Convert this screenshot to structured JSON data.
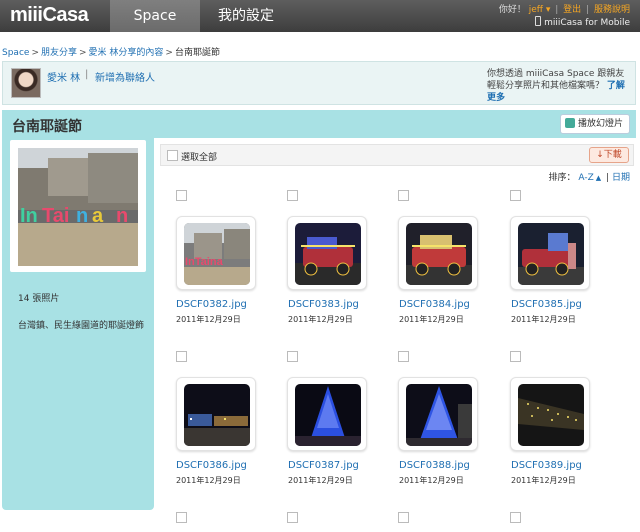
{
  "header": {
    "logo": "miiiCasa",
    "nav_space": "Space",
    "nav_settings": "我的設定",
    "greeting": "你好！",
    "username": "jeff",
    "logout": "登出",
    "help": "服務說明",
    "mobile": "miiiCasa for Mobile"
  },
  "breadcrumb": {
    "root": "Space",
    "friends_share": "朋友分享",
    "user_share": "愛米 林分享的內容",
    "current": "台南耶誕節"
  },
  "userbar": {
    "name": "愛米 林",
    "divider": "|",
    "add_friend": "新增為聯絡人",
    "promo_text": "你想透過 miiiCasa Space 跟親友輕鬆分享照片和其他檔案嗎？",
    "promo_link": "了解更多"
  },
  "album": {
    "title": "台南耶誕節",
    "slideshow": "播放幻燈片",
    "photo_count": "14 張照片",
    "description": "台灣鎮、民生綠園道的耶誕燈飾"
  },
  "toolbar": {
    "select_all": "選取全部",
    "download": "下載",
    "sort_label": "排序：",
    "sort_az": "A-Z",
    "sort_sep": "|",
    "sort_date": "日期"
  },
  "photos": [
    {
      "name": "DSCF0382.jpg",
      "date": "2011年12月29日"
    },
    {
      "name": "DSCF0383.jpg",
      "date": "2011年12月29日"
    },
    {
      "name": "DSCF0384.jpg",
      "date": "2011年12月29日"
    },
    {
      "name": "DSCF0385.jpg",
      "date": "2011年12月29日"
    },
    {
      "name": "DSCF0386.jpg",
      "date": "2011年12月29日"
    },
    {
      "name": "DSCF0387.jpg",
      "date": "2011年12月29日"
    },
    {
      "name": "DSCF0388.jpg",
      "date": "2011年12月29日"
    },
    {
      "name": "DSCF0389.jpg",
      "date": "2011年12月29日"
    }
  ]
}
